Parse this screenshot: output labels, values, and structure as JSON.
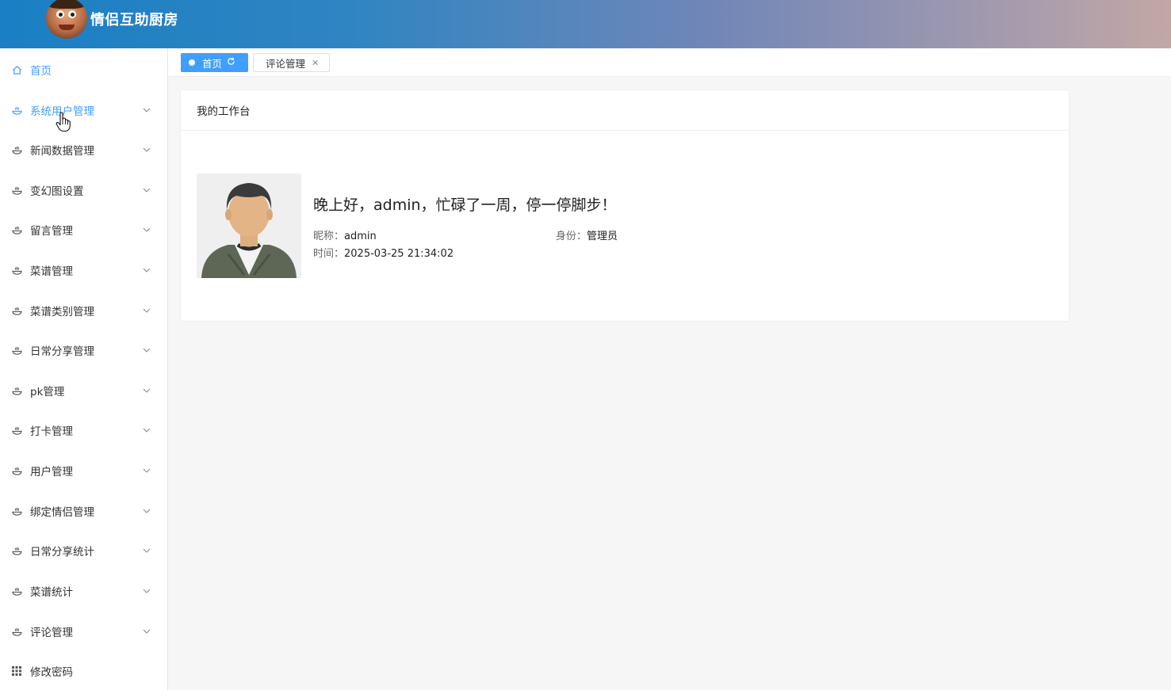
{
  "header": {
    "title": "情侣互助厨房",
    "logo_icon": "cartoon-avatar-logo"
  },
  "sidebar": {
    "items": [
      {
        "label": "首页",
        "icon": "home-icon",
        "has_arrow": false,
        "active": true
      },
      {
        "label": "系统用户管理",
        "icon": "bowl-icon",
        "has_arrow": true,
        "hover": true
      },
      {
        "label": "新闻数据管理",
        "icon": "bowl-icon",
        "has_arrow": true
      },
      {
        "label": "变幻图设置",
        "icon": "bowl-icon",
        "has_arrow": true
      },
      {
        "label": "留言管理",
        "icon": "bowl-icon",
        "has_arrow": true
      },
      {
        "label": "菜谱管理",
        "icon": "bowl-icon",
        "has_arrow": true
      },
      {
        "label": "菜谱类别管理",
        "icon": "bowl-icon",
        "has_arrow": true
      },
      {
        "label": "日常分享管理",
        "icon": "bowl-icon",
        "has_arrow": true
      },
      {
        "label": "pk管理",
        "icon": "bowl-icon",
        "has_arrow": true
      },
      {
        "label": "打卡管理",
        "icon": "bowl-icon",
        "has_arrow": true
      },
      {
        "label": "用户管理",
        "icon": "bowl-icon",
        "has_arrow": true
      },
      {
        "label": "绑定情侣管理",
        "icon": "bowl-icon",
        "has_arrow": true
      },
      {
        "label": "日常分享统计",
        "icon": "bowl-icon",
        "has_arrow": true
      },
      {
        "label": "菜谱统计",
        "icon": "bowl-icon",
        "has_arrow": true
      },
      {
        "label": "评论管理",
        "icon": "bowl-icon",
        "has_arrow": true
      },
      {
        "label": "修改密码",
        "icon": "grid-icon",
        "has_arrow": false
      }
    ]
  },
  "tabs": [
    {
      "label": "首页",
      "active": true
    },
    {
      "label": "评论管理",
      "active": false
    }
  ],
  "workbench": {
    "title": "我的工作台",
    "greeting": "晚上好，admin，忙碌了一周，停一停脚步！",
    "nickname_label": "昵称：",
    "nickname": "admin",
    "role_label": "身份：",
    "role": "管理员",
    "time_label": "时间：",
    "time": "2025-03-25 21:34:02"
  },
  "colors": {
    "accent": "#409eff",
    "header_start": "#1a7fc4",
    "header_end": "#c3a7a5"
  }
}
